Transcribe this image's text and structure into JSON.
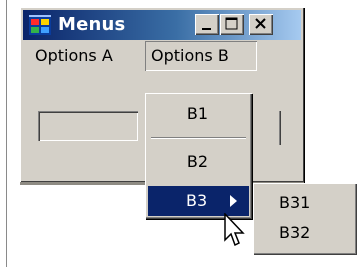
{
  "window": {
    "title": "Menus",
    "caption_buttons": [
      "minimize",
      "maximize",
      "close"
    ]
  },
  "menubar": {
    "items": [
      {
        "label": "Options A"
      },
      {
        "label": "Options B"
      }
    ]
  },
  "dropdown": {
    "items": [
      {
        "label": "B1"
      },
      {
        "label": "B2"
      },
      {
        "label": "B3"
      }
    ]
  },
  "submenu": {
    "items": [
      {
        "label": "B31"
      },
      {
        "label": "B32"
      }
    ]
  },
  "icons": {
    "app": "application-icon",
    "submenu_arrow": "chevron-right-icon",
    "cursor": "mouse-pointer-icon"
  },
  "colors": {
    "face": "#d4d0c8",
    "title_active": "#0a246a",
    "highlight": "#0a246a",
    "highlight_text": "#ffffff"
  }
}
